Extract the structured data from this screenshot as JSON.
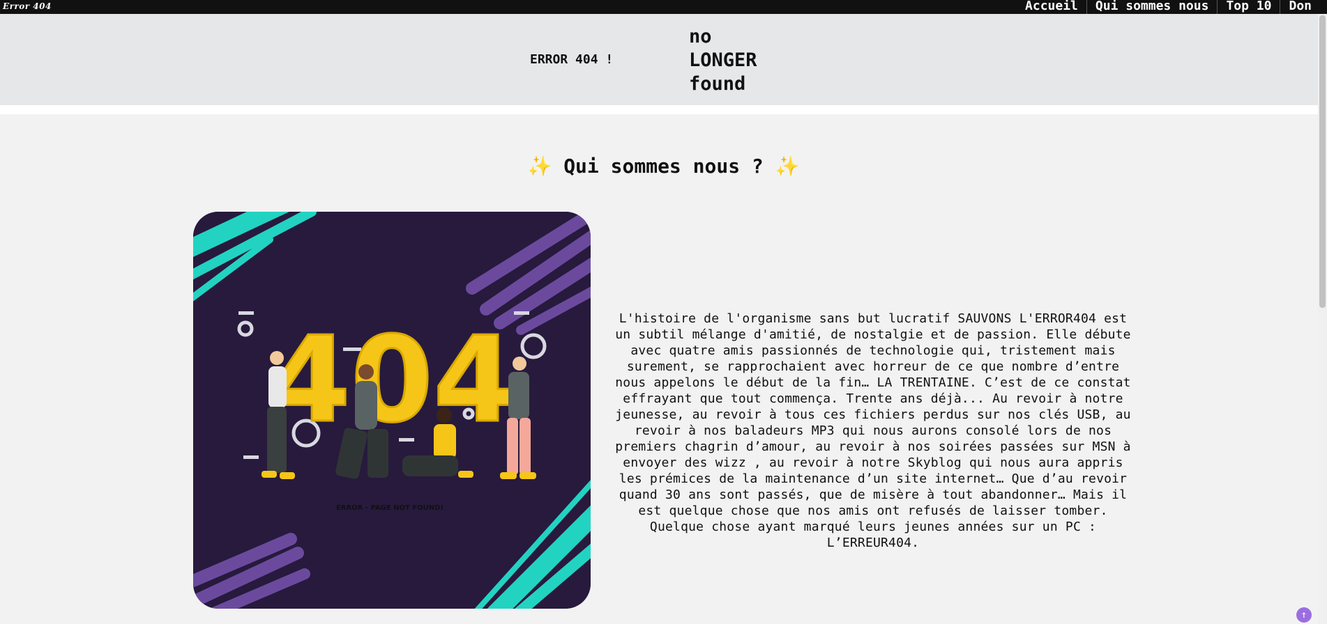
{
  "brand": "Error 404",
  "nav": {
    "items": [
      "Accueil",
      "Qui sommes nous",
      "Top 10",
      "Don"
    ]
  },
  "header": {
    "error_label": "ERROR 404 !",
    "title_line1": "no",
    "title_line2": "LONGER",
    "title_line3": "found"
  },
  "section": {
    "sparkle_left": "✨",
    "title": "Qui sommes nous ?",
    "sparkle_right": "✨"
  },
  "illustration": {
    "caption": "ERROR - PAGE NOT FOUND!",
    "big_text": "404"
  },
  "story": {
    "text": "L'histoire de l'organisme sans but lucratif SAUVONS L'ERROR404 est un subtil mélange d'amitié, de nostalgie et de passion. Elle débute avec quatre amis passionnés de technologie qui, tristement mais surement, se rapprochaient avec horreur de ce que nombre d’entre nous appelons le début de la fin… LA TRENTAINE. C’est de ce constat effrayant que tout commença. Trente ans déjà... Au revoir à notre jeunesse, au revoir à tous ces fichiers perdus sur nos clés USB, au revoir à nos baladeurs MP3 qui nous aurons consolé lors de nos premiers chagrin d’amour, au revoir à nos soirées passées sur MSN à envoyer des wizz , au revoir à notre Skyblog qui nous aura appris les prémices de la maintenance d’un site internet… Que d’au revoir quand 30 ans sont passés, que de misère à tout abandonner… Mais il est quelque chose que nos amis ont refusés de laisser tomber. Quelque chose ayant marqué leurs jeunes années sur un PC : L’ERREUR404."
  },
  "back_to_top": {
    "icon": "arrow-up-icon",
    "glyph": "↑"
  },
  "colors": {
    "topbar": "#111111",
    "header_band": "#e6e7e9",
    "page_bg": "#f2f2f2",
    "illustration_bg": "#271a3d",
    "teal": "#22d3c2",
    "purple": "#6b4a9e",
    "yellow": "#f5c518",
    "accent_button": "#9b6ee0"
  }
}
